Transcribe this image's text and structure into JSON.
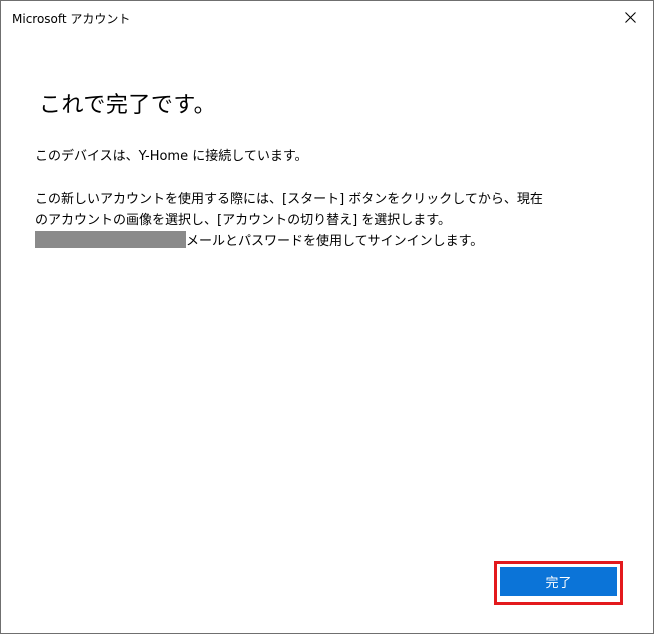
{
  "window": {
    "title": "Microsoft アカウント"
  },
  "content": {
    "heading": "これで完了です。",
    "connected_message": "このデバイスは、Y-Home に接続しています。",
    "instructions": {
      "line1": "この新しいアカウントを使用する際には、[スタート] ボタンをクリックしてから、現在",
      "line2": "のアカウントの画像を選択し、[アカウントの切り替え] を選択します。",
      "line3_suffix": "メールとパスワードを使用してサインインします。"
    }
  },
  "footer": {
    "done_label": "完了"
  },
  "colors": {
    "accent": "#0b74d8",
    "highlight": "#e3191d",
    "redaction": "#8a8a8a"
  },
  "icons": {
    "close": "close-icon"
  }
}
